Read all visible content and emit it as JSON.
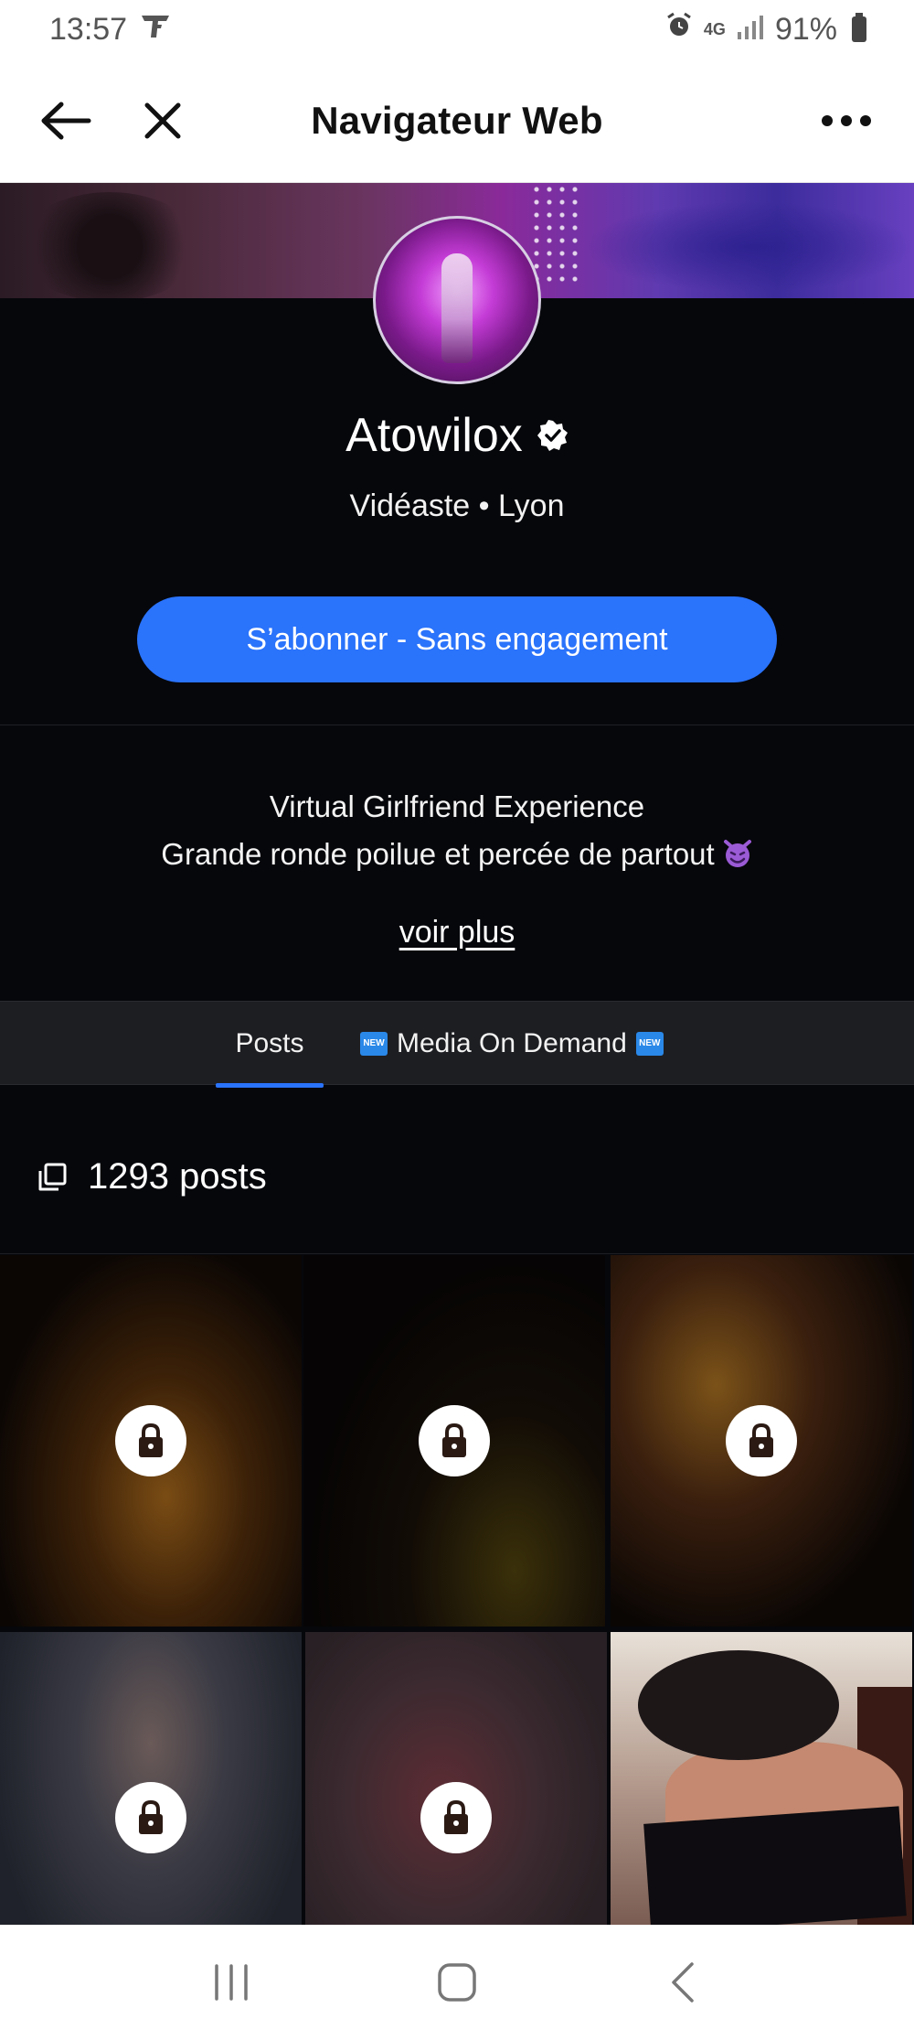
{
  "status_bar": {
    "time": "13:57",
    "network": "4G",
    "battery": "91%"
  },
  "header": {
    "title": "Navigateur Web"
  },
  "profile": {
    "name": "Atowilox",
    "subtitle": "Vidéaste • Lyon",
    "subscribe_label": "S’abonner - Sans engagement",
    "bio_line1": "Virtual Girlfriend Experience",
    "bio_line2": "Grande ronde poilue et percée de partout",
    "see_more": "voir plus"
  },
  "tabs": [
    {
      "label": "Posts",
      "active": true
    },
    {
      "label": "Media On Demand",
      "badge": "NEW",
      "active": false
    }
  ],
  "posts": {
    "count_label": "1293 posts",
    "tiles": [
      {
        "locked": true
      },
      {
        "locked": true
      },
      {
        "locked": true
      },
      {
        "locked": true
      },
      {
        "locked": true
      },
      {
        "locked": false
      }
    ]
  },
  "colors": {
    "accent": "#2a73fb",
    "page_background": "#06070b",
    "tab_bar": "#1d1e22"
  }
}
